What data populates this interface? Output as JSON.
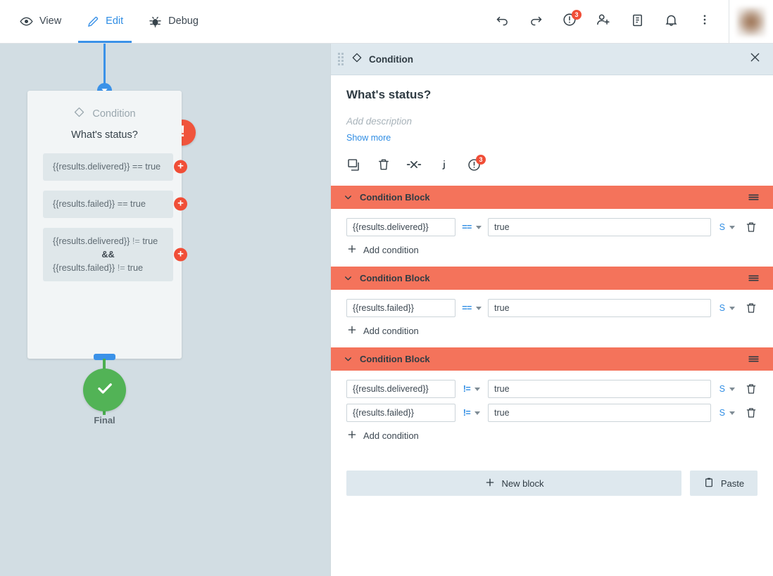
{
  "topbar": {
    "tabs": [
      {
        "label": "View",
        "icon": "eye-icon",
        "active": false
      },
      {
        "label": "Edit",
        "icon": "pencil-icon",
        "active": true
      },
      {
        "label": "Debug",
        "icon": "bug-icon",
        "active": false
      }
    ],
    "actions": [
      {
        "name": "undo-icon",
        "badge": ""
      },
      {
        "name": "redo-icon",
        "badge": ""
      },
      {
        "name": "alert-icon",
        "badge": "3"
      },
      {
        "name": "add-user-icon",
        "badge": ""
      },
      {
        "name": "clipboard-icon",
        "badge": ""
      },
      {
        "name": "bell-icon",
        "badge": ""
      },
      {
        "name": "more-vertical-icon",
        "badge": ""
      }
    ]
  },
  "canvas": {
    "node": {
      "type_label": "Condition",
      "title": "What's status?",
      "rows": [
        {
          "text": "{{results.delivered}} == true",
          "lhs": "{{results.delivered}}",
          "op": "==",
          "rhs": "true",
          "multi": false
        },
        {
          "text": "{{results.failed}} == true",
          "lhs": "{{results.failed}}",
          "op": "==",
          "rhs": "true",
          "multi": false
        },
        {
          "text": "{{results.delivered}} != true && {{results.failed}} != true",
          "lhs": "{{results.delivered}}",
          "op": "!=",
          "rhs": "true",
          "joiner": "&&",
          "lhs2": "{{results.failed}}",
          "op2": "!=",
          "rhs2": "true",
          "multi": true
        }
      ],
      "warning_icon": "!",
      "plus_icon": "+"
    },
    "final_node": {
      "label": "Final",
      "icon": "check-icon"
    },
    "colors": {
      "canvas_bg": "#d2dde3",
      "connector_blue": "#3b92e8",
      "connector_green": "#4caf50",
      "final_green": "#52b356",
      "warning_red": "#f0543c"
    }
  },
  "panel": {
    "header": {
      "title": "Condition",
      "icon": "diamond-icon",
      "close_icon": "close-icon",
      "drag_handle": "drag-handle-icon"
    },
    "form": {
      "title": "What's status?",
      "description_placeholder": "Add description",
      "show_more_label": "Show more"
    },
    "actions": [
      {
        "name": "copy-icon",
        "badge": ""
      },
      {
        "name": "trash-icon",
        "badge": ""
      },
      {
        "name": "disconnect-icon",
        "badge": ""
      },
      {
        "name": "info-icon",
        "badge": ""
      },
      {
        "name": "alert-icon",
        "badge": "3"
      }
    ],
    "blocks": [
      {
        "title": "Condition Block",
        "add_condition_label": "Add condition",
        "conditions": [
          {
            "left": "{{results.delivered}}",
            "operator": "==",
            "right": "true",
            "type": "S"
          }
        ]
      },
      {
        "title": "Condition Block",
        "add_condition_label": "Add condition",
        "conditions": [
          {
            "left": "{{results.failed}}",
            "operator": "==",
            "right": "true",
            "type": "S"
          }
        ]
      },
      {
        "title": "Condition Block",
        "add_condition_label": "Add condition",
        "conditions": [
          {
            "left": "{{results.delivered}}",
            "operator": "!=",
            "right": "true",
            "type": "S"
          },
          {
            "left": "{{results.failed}}",
            "operator": "!=",
            "right": "true",
            "type": "S"
          }
        ]
      }
    ],
    "footer": {
      "new_block_label": "New block",
      "paste_label": "Paste"
    },
    "colors": {
      "block_header_bg": "#f4735b",
      "panel_header_bg": "#dee8ee",
      "accent_blue": "#2f8de4",
      "button_bg": "#dee8ee"
    }
  }
}
